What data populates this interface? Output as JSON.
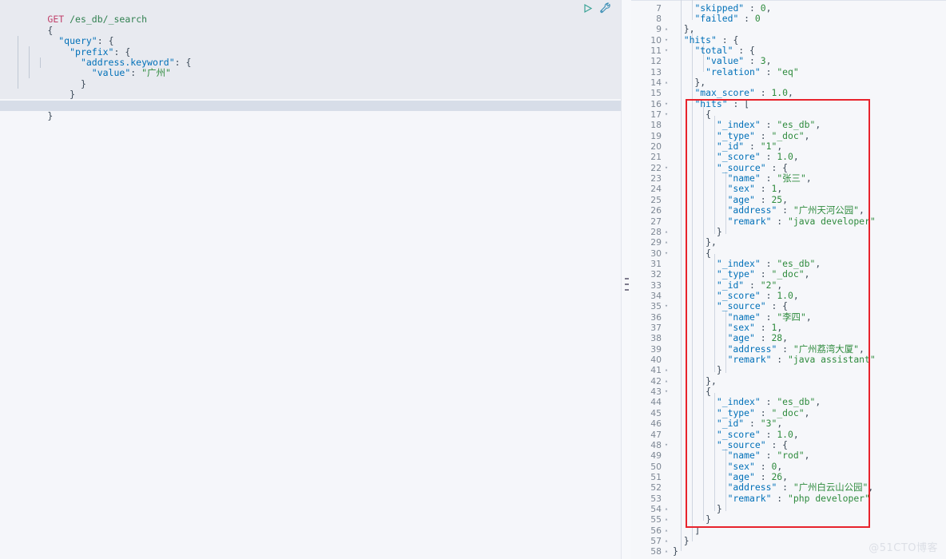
{
  "request": {
    "method": "GET",
    "path": "/es_db/_search",
    "actions": {
      "play_label": "play-icon",
      "wrench_label": "wrench-icon"
    },
    "lines": [
      "{",
      "   \"query\": {",
      "     \"prefix\": {",
      "       \"address.keyword\": {",
      "         \"value\": \"广州\"",
      "       }",
      "     }",
      "   }",
      "}"
    ],
    "body": {
      "query": {
        "prefix": {
          "address.keyword": {
            "value": "广州"
          }
        }
      }
    }
  },
  "splitter": {
    "handle_label": "drag-handle"
  },
  "response": {
    "first_line_number": 7,
    "lines": [
      {
        "n": 7,
        "fold": "",
        "text": "    \"skipped\" : 0,"
      },
      {
        "n": 8,
        "fold": "",
        "text": "    \"failed\" : 0"
      },
      {
        "n": 9,
        "fold": "▴",
        "text": "  },"
      },
      {
        "n": 10,
        "fold": "▾",
        "text": "  \"hits\" : {"
      },
      {
        "n": 11,
        "fold": "▾",
        "text": "    \"total\" : {"
      },
      {
        "n": 12,
        "fold": "",
        "text": "      \"value\" : 3,"
      },
      {
        "n": 13,
        "fold": "",
        "text": "      \"relation\" : \"eq\""
      },
      {
        "n": 14,
        "fold": "▴",
        "text": "    },"
      },
      {
        "n": 15,
        "fold": "",
        "text": "    \"max_score\" : 1.0,"
      },
      {
        "n": 16,
        "fold": "▾",
        "text": "    \"hits\" : ["
      },
      {
        "n": 17,
        "fold": "▾",
        "text": "      {"
      },
      {
        "n": 18,
        "fold": "",
        "text": "        \"_index\" : \"es_db\","
      },
      {
        "n": 19,
        "fold": "",
        "text": "        \"_type\" : \"_doc\","
      },
      {
        "n": 20,
        "fold": "",
        "text": "        \"_id\" : \"1\","
      },
      {
        "n": 21,
        "fold": "",
        "text": "        \"_score\" : 1.0,"
      },
      {
        "n": 22,
        "fold": "▾",
        "text": "        \"_source\" : {"
      },
      {
        "n": 23,
        "fold": "",
        "text": "          \"name\" : \"张三\","
      },
      {
        "n": 24,
        "fold": "",
        "text": "          \"sex\" : 1,"
      },
      {
        "n": 25,
        "fold": "",
        "text": "          \"age\" : 25,"
      },
      {
        "n": 26,
        "fold": "",
        "text": "          \"address\" : \"广州天河公园\","
      },
      {
        "n": 27,
        "fold": "",
        "text": "          \"remark\" : \"java developer\""
      },
      {
        "n": 28,
        "fold": "▴",
        "text": "        }"
      },
      {
        "n": 29,
        "fold": "▴",
        "text": "      },"
      },
      {
        "n": 30,
        "fold": "▾",
        "text": "      {"
      },
      {
        "n": 31,
        "fold": "",
        "text": "        \"_index\" : \"es_db\","
      },
      {
        "n": 32,
        "fold": "",
        "text": "        \"_type\" : \"_doc\","
      },
      {
        "n": 33,
        "fold": "",
        "text": "        \"_id\" : \"2\","
      },
      {
        "n": 34,
        "fold": "",
        "text": "        \"_score\" : 1.0,"
      },
      {
        "n": 35,
        "fold": "▾",
        "text": "        \"_source\" : {"
      },
      {
        "n": 36,
        "fold": "",
        "text": "          \"name\" : \"李四\","
      },
      {
        "n": 37,
        "fold": "",
        "text": "          \"sex\" : 1,"
      },
      {
        "n": 38,
        "fold": "",
        "text": "          \"age\" : 28,"
      },
      {
        "n": 39,
        "fold": "",
        "text": "          \"address\" : \"广州荔湾大厦\","
      },
      {
        "n": 40,
        "fold": "",
        "text": "          \"remark\" : \"java assistant\""
      },
      {
        "n": 41,
        "fold": "▴",
        "text": "        }"
      },
      {
        "n": 42,
        "fold": "▴",
        "text": "      },"
      },
      {
        "n": 43,
        "fold": "▾",
        "text": "      {"
      },
      {
        "n": 44,
        "fold": "",
        "text": "        \"_index\" : \"es_db\","
      },
      {
        "n": 45,
        "fold": "",
        "text": "        \"_type\" : \"_doc\","
      },
      {
        "n": 46,
        "fold": "",
        "text": "        \"_id\" : \"3\","
      },
      {
        "n": 47,
        "fold": "",
        "text": "        \"_score\" : 1.0,"
      },
      {
        "n": 48,
        "fold": "▾",
        "text": "        \"_source\" : {"
      },
      {
        "n": 49,
        "fold": "",
        "text": "          \"name\" : \"rod\","
      },
      {
        "n": 50,
        "fold": "",
        "text": "          \"sex\" : 0,"
      },
      {
        "n": 51,
        "fold": "",
        "text": "          \"age\" : 26,"
      },
      {
        "n": 52,
        "fold": "",
        "text": "          \"address\" : \"广州白云山公园\","
      },
      {
        "n": 53,
        "fold": "",
        "text": "          \"remark\" : \"php developer\""
      },
      {
        "n": 54,
        "fold": "▴",
        "text": "        }"
      },
      {
        "n": 55,
        "fold": "▴",
        "text": "      }"
      },
      {
        "n": 56,
        "fold": "▴",
        "text": "    ]"
      },
      {
        "n": 57,
        "fold": "▴",
        "text": "  }"
      },
      {
        "n": 58,
        "fold": "▴",
        "text": "}"
      }
    ],
    "hits": {
      "total": {
        "value": 3,
        "relation": "eq"
      },
      "max_score": 1.0,
      "documents": [
        {
          "_index": "es_db",
          "_type": "_doc",
          "_id": "1",
          "_score": 1.0,
          "_source": {
            "name": "张三",
            "sex": 1,
            "age": 25,
            "address": "广州天河公园",
            "remark": "java developer"
          }
        },
        {
          "_index": "es_db",
          "_type": "_doc",
          "_id": "2",
          "_score": 1.0,
          "_source": {
            "name": "李四",
            "sex": 1,
            "age": 28,
            "address": "广州荔湾大厦",
            "remark": "java assistant"
          }
        },
        {
          "_index": "es_db",
          "_type": "_doc",
          "_id": "3",
          "_score": 1.0,
          "_source": {
            "name": "rod",
            "sex": 0,
            "age": 26,
            "address": "广州白云山公园",
            "remark": "php developer"
          }
        }
      ]
    },
    "shards": {
      "skipped": 0,
      "failed": 0
    }
  },
  "annotation": {
    "red_box_label": "hits-array-highlight",
    "color": "#e8232c"
  },
  "watermark": {
    "text": "@51CTO博客"
  },
  "colors": {
    "editor_background": "#e8eaf0",
    "active_line": "#d7dde8",
    "response_background": "#f6f7fa",
    "key": "#0070b8",
    "string": "#2e8b3d",
    "method": "#c1416b",
    "url": "#2f7f4f",
    "line_number": "#7d8794"
  }
}
